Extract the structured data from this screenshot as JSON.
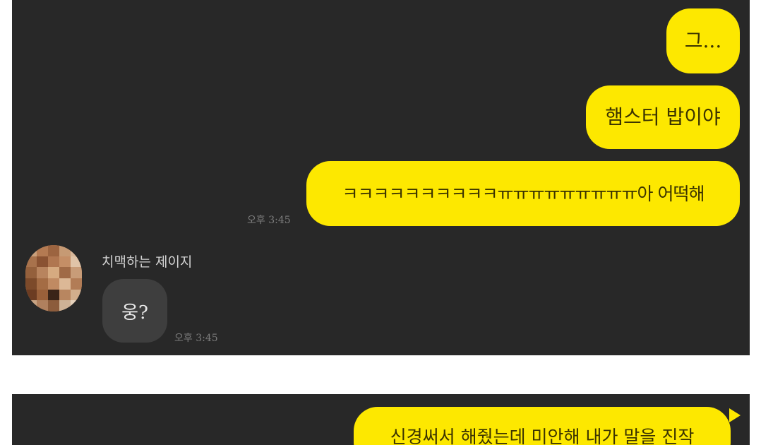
{
  "chat_top": {
    "messages_out": [
      {
        "text": "그..."
      },
      {
        "text": "햄스터 밥이야"
      },
      {
        "text": "ㅋㅋㅋㅋㅋㅋㅋㅋㅋㅋㅠㅠㅠㅠㅠㅠㅠㅠㅠ아 어떡해",
        "time": "오후 3:45"
      }
    ],
    "incoming": {
      "sender": "치맥하는 제이지",
      "text": "웅?",
      "time": "오후 3:45"
    }
  },
  "chat_bottom": {
    "message_out": {
      "text": "신경써서 해줬는데 미안해 내가 말을 진작"
    }
  },
  "colors": {
    "background": "#282828",
    "bubble_out": "#fde800",
    "bubble_in": "#3e3e3e",
    "page": "#ffffff"
  },
  "icons": {
    "avatar": "blurred-profile-avatar"
  }
}
